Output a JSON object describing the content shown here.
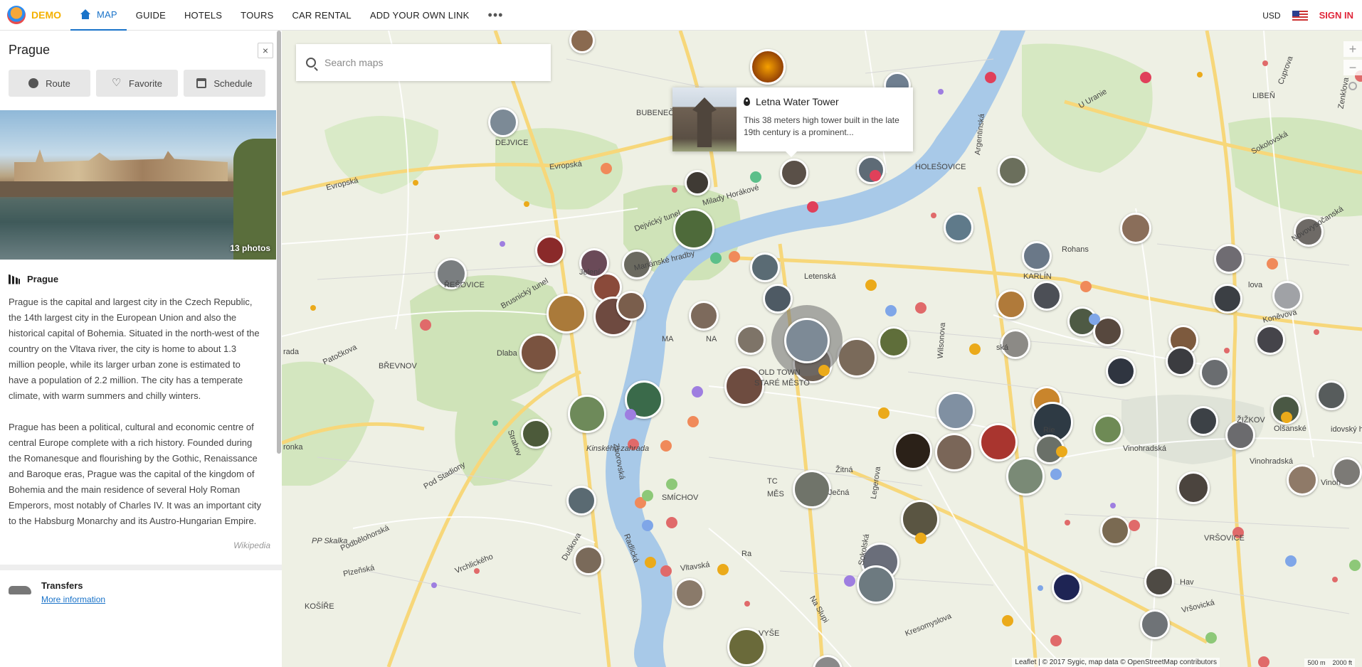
{
  "app": {
    "logo_text": "DEMO",
    "nav": [
      {
        "label": "MAP",
        "active": true
      },
      {
        "label": "GUIDE"
      },
      {
        "label": "HOTELS"
      },
      {
        "label": "TOURS"
      },
      {
        "label": "CAR RENTAL"
      },
      {
        "label": "ADD YOUR OWN LINK"
      }
    ],
    "more_label": "•••",
    "currency": "USD",
    "flag_icon": "us-flag-icon",
    "signin_label": "SIGN IN"
  },
  "sidebar": {
    "title": "Prague",
    "close_label": "×",
    "actions": {
      "route": "Route",
      "favorite": "Favorite",
      "schedule": "Schedule"
    },
    "photos_count": "13 photos",
    "section_title": "Prague",
    "description": [
      "Prague is the capital and largest city in the Czech Republic, the 14th largest city in the European Union and also the historical capital of Bohemia. Situated in the north-west of the country on the Vltava river, the city is home to about 1.3 million people, while its larger urban zone is estimated to have a population of 2.2 million. The city has a temperate climate, with warm summers and chilly winters.",
      "Prague has been a political, cultural and economic centre of central Europe complete with a rich history. Founded during the Romanesque and flourishing by the Gothic, Renaissance and Baroque eras, Prague was the capital of the kingdom of Bohemia and the main residence of several Holy Roman Emperors, most notably of Charles IV. It was an important city to the Habsburg Monarchy and its Austro-Hungarian Empire."
    ],
    "source": "Wikipedia",
    "transfers_title": "Transfers",
    "transfers_link": "More information"
  },
  "map": {
    "search_placeholder": "Search maps",
    "popup": {
      "title": "Letna Water Tower",
      "text": "This 38 meters high tower built in the late 19th century is a prominent..."
    },
    "zoom_in": "+",
    "zoom_out": "−",
    "attribution": "Leaflet | © 2017 Sygic, map data © OpenStreetMap contributors",
    "scale_metric": "500 m",
    "scale_imperial": "2000 ft",
    "labels": {
      "bubenec": "BUBENEČ",
      "dejvice": "DEJVICE",
      "holesovice": "HOLEŠOVICE",
      "liben": "LIBEŇ",
      "karlin": "KARLÍN",
      "brevnov": "BŘEVNOV",
      "stresovice": "ŘEŠOVICE",
      "old_town_1": "OLD TOWN",
      "old_town_2": "STARÉ MĚSTO",
      "zizkov": "ŽIŽKOV",
      "smichov": "SMÍCHOV",
      "vrsovice": "VRŠOVICE",
      "kosire": "KOŠÍŘE",
      "vysehrad": "VYŠE",
      "mala_strana": "MA",
      "mala_strana_2": "NA",
      "kinskeho": "Kinského zahrada",
      "vinohradska": "Vinohradská",
      "vinohradska2": "Vinohradská",
      "olsanske": "Olšanské",
      "olsanske2": "idovský hřbitov",
      "evropska": "Evropská",
      "evropska2": "Evropská",
      "patockova": "Patočkova",
      "podbelohorska": "Podbělohorská",
      "plzenska": "Plzeňská",
      "pp_skalka": "PP Skalka",
      "vrchlickeho": "Vrchlického",
      "dejvicky_tunel": "Dejvický tunel",
      "milady": "Milady Horákové",
      "argentinska": "Argentinská",
      "rohanske": "Rohans",
      "konevova": "Koněvova",
      "sokolovska": "Sokolovská",
      "zitna": "Žitná",
      "jecna": "Ječná",
      "legerova": "Legerova",
      "sokolska": "Sokolská",
      "vrsovicka": "Vršovická",
      "kresomyslova": "Kresomyslova",
      "svatoplukova": "Vinoh",
      "radlicka": "Radlická",
      "duskova": "Duškova",
      "zborovska": "Zborovská",
      "vltavska": "Vltavská",
      "na_slupi": "Na Slupi",
      "wilsonova": "Wilsonova",
      "rieg": "Rie",
      "kavarna": "Hav",
      "cupova": "Cuprova",
      "novovysocanska": "Novovysočanská",
      "jana_masaryka": "lova",
      "sarka": "rada",
      "ronka": "ronka",
      "pod_stadiony": "Pod Stadiony",
      "strahovska": "Strahov",
      "brusnicky": "Brusnický tunel",
      "dlabacov": "Dlaba",
      "jelen": "Jelení",
      "marianske": "Mariánské hradby",
      "letenska": "Letenská",
      "liben_2": "Zenklova",
      "u_uranie": "U Uranie",
      "vysehradska": "Ra",
      "ska": "ská",
      "mes": "MĚS",
      "tc": "TC"
    }
  }
}
